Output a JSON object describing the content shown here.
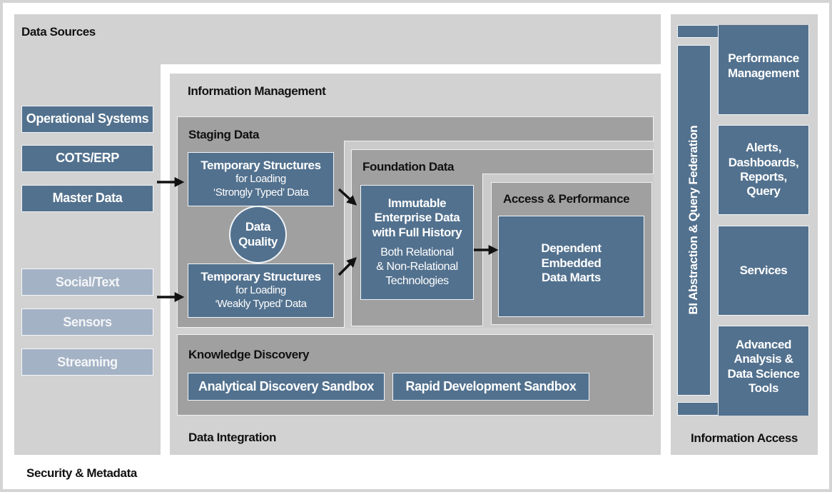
{
  "data_sources": {
    "title": "Data Sources",
    "structured": [
      "Operational Systems",
      "COTS/ERP",
      "Master Data"
    ],
    "unstructured": [
      "Social/Text",
      "Sensors",
      "Streaming"
    ]
  },
  "security_metadata": "Security & Metadata",
  "information_management": {
    "title": "Information Management",
    "staging": {
      "title": "Staging Data",
      "strong": {
        "title": "Temporary Structures",
        "sub": "for Loading\n‘Strongly Typed’ Data"
      },
      "weak": {
        "title": "Temporary Structures",
        "sub": "for Loading\n‘Weakly Typed’ Data"
      },
      "quality": "Data\nQuality"
    },
    "foundation": {
      "title": "Foundation Data",
      "box_title": "Immutable\nEnterprise Data\nwith Full History",
      "box_sub": "Both Relational\n& Non-Relational\nTechnologies"
    },
    "access": {
      "title": "Access & Performance",
      "box": "Dependent\nEmbedded\nData Marts"
    },
    "knowledge": {
      "title": "Knowledge Discovery",
      "items": [
        "Analytical Discovery Sandbox",
        "Rapid Development Sandbox"
      ]
    },
    "integration": "Data Integration"
  },
  "information_access": {
    "title": "Information Access",
    "federation": "BI Abstraction & Query Federation",
    "items": [
      "Performance\nManagement",
      "Alerts,\nDashboards,\nReports,\nQuery",
      "Services",
      "Advanced\nAnalysis &\nData Science\nTools"
    ]
  },
  "colors": {
    "dark_blue": "#52718e",
    "pale_blue": "#a4b2c5",
    "light_gray": "#d2d2d2",
    "mid_gray": "#a0a0a0"
  }
}
